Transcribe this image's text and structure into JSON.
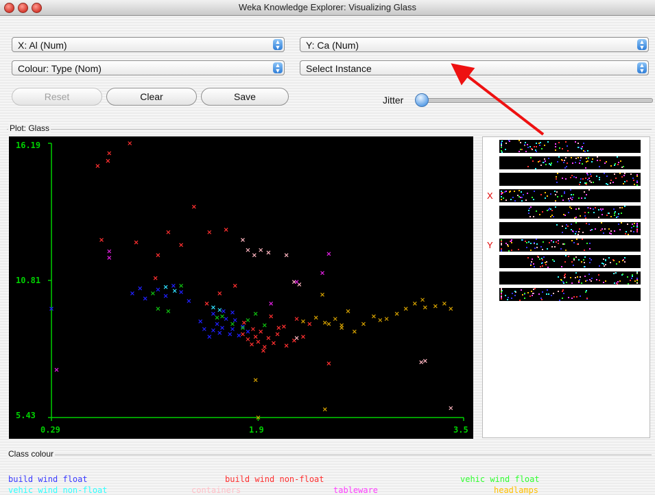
{
  "window": {
    "title": "Weka Knowledge Explorer: Visualizing Glass"
  },
  "controls": {
    "x_axis": "X: Al (Num)",
    "y_axis": "Y: Ca (Num)",
    "colour": "Colour: Type (Nom)",
    "instance": "Select Instance",
    "reset": "Reset",
    "clear": "Clear",
    "save": "Save",
    "jitter": "Jitter",
    "jitter_level": 0
  },
  "plot": {
    "title": "Plot: Glass",
    "axis_color": "#00d000"
  },
  "attribute_panel": {
    "x_marker": "X",
    "y_marker": "Y",
    "x_row": 4,
    "y_row": 7,
    "strip_count": 10
  },
  "legend": {
    "title": "Class colour",
    "items": [
      {
        "label": "build wind float",
        "color": "#3a3aff"
      },
      {
        "label": "build wind non-float",
        "color": "#ff3030"
      },
      {
        "label": "vehic wind float",
        "color": "#30ff30"
      },
      {
        "label": "vehic wind non-float",
        "color": "#30ffff"
      },
      {
        "label": "containers",
        "color": "#ffc0c8"
      },
      {
        "label": "tableware",
        "color": "#ff40ff"
      },
      {
        "label": "headlamps",
        "color": "#ffc000"
      }
    ]
  },
  "chart_data": {
    "type": "scatter",
    "title": "Plot: Glass",
    "xlabel": "Al",
    "ylabel": "Ca",
    "xlim": [
      0.29,
      3.5
    ],
    "ylim": [
      5.43,
      16.19
    ],
    "x_ticks": [
      "0.29",
      "1.9",
      "3.5"
    ],
    "y_ticks": [
      "16.19",
      "10.81",
      "5.43"
    ],
    "marker": "x",
    "series": [
      {
        "name": "build wind float",
        "color": "#2020ff",
        "points": [
          [
            0.29,
            9.7
          ],
          [
            0.92,
            10.3
          ],
          [
            0.98,
            10.5
          ],
          [
            1.02,
            10.1
          ],
          [
            1.12,
            10.45
          ],
          [
            1.18,
            10.2
          ],
          [
            1.24,
            10.6
          ],
          [
            1.3,
            10.35
          ],
          [
            1.36,
            10.0
          ],
          [
            1.45,
            9.2
          ],
          [
            1.48,
            8.9
          ],
          [
            1.52,
            8.6
          ],
          [
            1.55,
            8.85
          ],
          [
            1.58,
            9.1
          ],
          [
            1.6,
            8.75
          ],
          [
            1.62,
            8.95
          ],
          [
            1.65,
            9.3
          ],
          [
            1.68,
            8.7
          ],
          [
            1.7,
            8.9
          ],
          [
            1.72,
            9.25
          ],
          [
            1.75,
            8.65
          ],
          [
            1.78,
            9.0
          ],
          [
            1.82,
            8.8
          ],
          [
            1.55,
            9.5
          ],
          [
            1.63,
            9.6
          ],
          [
            1.7,
            9.55
          ]
        ]
      },
      {
        "name": "build wind non-float",
        "color": "#ff3030",
        "points": [
          [
            0.65,
            15.3
          ],
          [
            0.73,
            15.5
          ],
          [
            0.74,
            15.8
          ],
          [
            0.68,
            12.4
          ],
          [
            0.9,
            16.19
          ],
          [
            0.95,
            12.3
          ],
          [
            1.12,
            11.8
          ],
          [
            1.2,
            12.7
          ],
          [
            1.1,
            10.9
          ],
          [
            1.3,
            12.2
          ],
          [
            1.4,
            13.7
          ],
          [
            1.52,
            12.7
          ],
          [
            1.65,
            12.8
          ],
          [
            1.78,
            8.7
          ],
          [
            1.82,
            8.5
          ],
          [
            1.85,
            8.3
          ],
          [
            1.88,
            8.6
          ],
          [
            1.9,
            8.4
          ],
          [
            1.92,
            8.8
          ],
          [
            1.95,
            8.2
          ],
          [
            1.98,
            8.55
          ],
          [
            2.02,
            8.35
          ],
          [
            2.05,
            8.7
          ],
          [
            2.1,
            9.0
          ],
          [
            2.12,
            8.25
          ],
          [
            2.18,
            8.45
          ],
          [
            2.2,
            9.3
          ],
          [
            2.3,
            9.1
          ],
          [
            2.45,
            7.55
          ],
          [
            1.6,
            10.3
          ],
          [
            1.72,
            10.6
          ],
          [
            1.5,
            9.9
          ],
          [
            1.86,
            8.9
          ],
          [
            2.0,
            9.4
          ],
          [
            1.79,
            9.15
          ],
          [
            2.25,
            8.6
          ],
          [
            1.94,
            8.05
          ],
          [
            2.06,
            8.95
          ]
        ]
      },
      {
        "name": "vehic wind float",
        "color": "#10c010",
        "points": [
          [
            1.08,
            10.3
          ],
          [
            1.12,
            9.7
          ],
          [
            1.2,
            9.6
          ],
          [
            1.3,
            10.6
          ],
          [
            1.62,
            9.4
          ],
          [
            1.7,
            9.1
          ],
          [
            1.78,
            8.95
          ],
          [
            1.82,
            9.25
          ],
          [
            1.88,
            9.5
          ],
          [
            1.95,
            9.05
          ],
          [
            1.58,
            9.35
          ]
        ]
      },
      {
        "name": "vehic wind non-float",
        "color": "#30e0ff",
        "points": [
          [
            1.18,
            10.55
          ],
          [
            1.25,
            10.4
          ],
          [
            1.55,
            9.75
          ],
          [
            1.6,
            9.65
          ]
        ]
      },
      {
        "name": "containers",
        "color": "#ffb6c1",
        "points": [
          [
            1.78,
            12.4
          ],
          [
            1.82,
            12.0
          ],
          [
            1.87,
            11.8
          ],
          [
            1.92,
            12.0
          ],
          [
            1.98,
            11.9
          ],
          [
            2.12,
            11.8
          ],
          [
            2.18,
            10.75
          ],
          [
            2.22,
            10.65
          ],
          [
            3.17,
            7.6
          ],
          [
            3.2,
            7.65
          ],
          [
            3.4,
            5.8
          ],
          [
            2.2,
            8.55
          ]
        ]
      },
      {
        "name": "tableware",
        "color": "#e020e0",
        "points": [
          [
            0.33,
            7.3
          ],
          [
            0.74,
            11.95
          ],
          [
            0.74,
            11.7
          ],
          [
            2.2,
            10.75
          ],
          [
            2.4,
            11.1
          ],
          [
            2.45,
            11.85
          ],
          [
            2.0,
            9.9
          ]
        ]
      },
      {
        "name": "headlamps",
        "color": "#d4a000",
        "points": [
          [
            1.9,
            5.43
          ],
          [
            1.88,
            6.9
          ],
          [
            2.42,
            5.75
          ],
          [
            2.25,
            9.2
          ],
          [
            2.35,
            9.35
          ],
          [
            2.45,
            9.1
          ],
          [
            2.5,
            9.3
          ],
          [
            2.55,
            9.05
          ],
          [
            2.65,
            8.8
          ],
          [
            2.72,
            9.1
          ],
          [
            2.8,
            9.4
          ],
          [
            2.85,
            9.25
          ],
          [
            2.9,
            9.3
          ],
          [
            2.98,
            9.5
          ],
          [
            3.05,
            9.7
          ],
          [
            3.12,
            9.9
          ],
          [
            3.2,
            9.75
          ],
          [
            3.28,
            9.8
          ],
          [
            3.35,
            9.9
          ],
          [
            3.4,
            9.7
          ],
          [
            2.4,
            10.25
          ],
          [
            2.6,
            9.6
          ],
          [
            3.18,
            10.05
          ],
          [
            2.42,
            9.15
          ],
          [
            2.55,
            8.95
          ]
        ]
      }
    ]
  }
}
